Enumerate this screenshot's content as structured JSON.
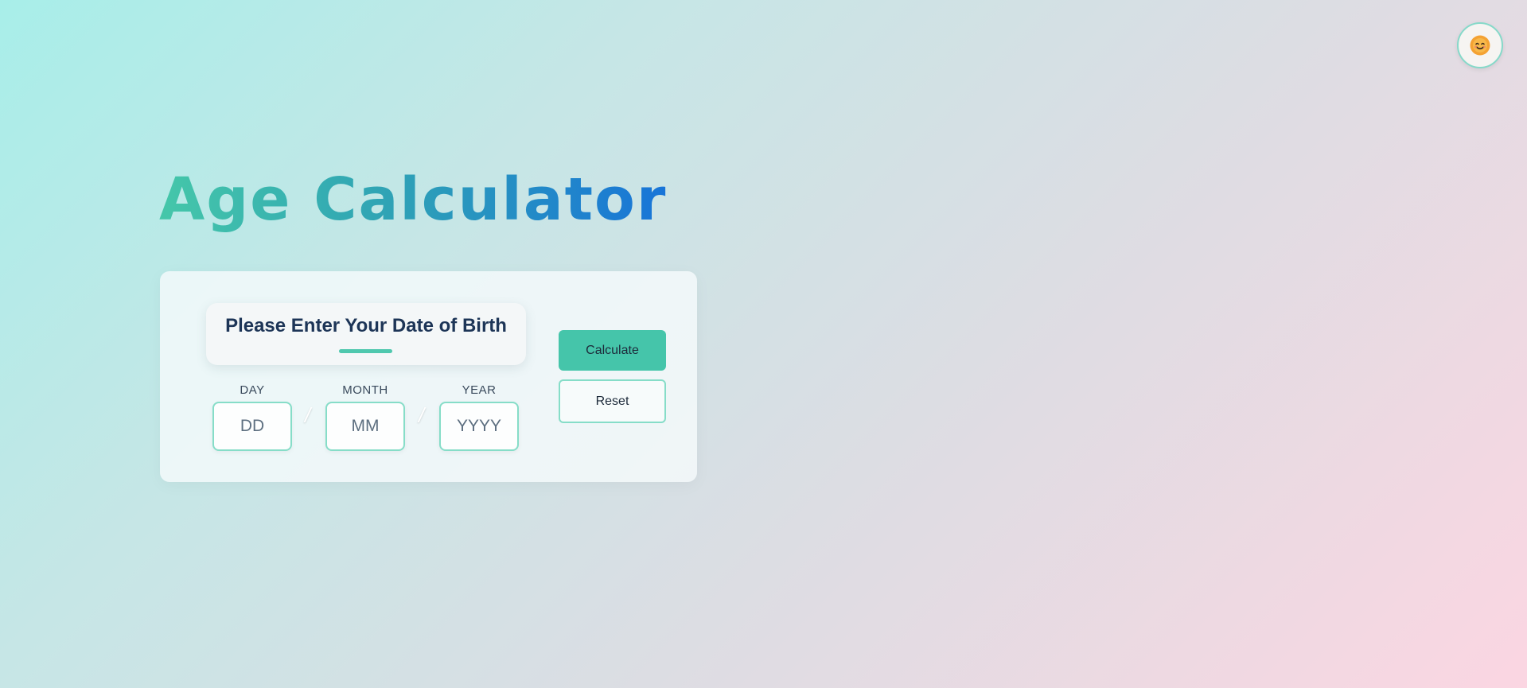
{
  "header": {
    "title": "Age Calculator",
    "theme_toggle_icon": "sun-face-icon"
  },
  "form": {
    "prompt": "Please Enter Your Date of Birth",
    "day": {
      "label": "DAY",
      "placeholder": "DD"
    },
    "month": {
      "label": "MONTH",
      "placeholder": "MM"
    },
    "year": {
      "label": "YEAR",
      "placeholder": "YYYY"
    },
    "separator": "/"
  },
  "actions": {
    "calculate_label": "Calculate",
    "reset_label": "Reset"
  },
  "colors": {
    "accent": "#45c5aa",
    "title_gradient_start": "#45c7a9",
    "title_gradient_end": "#1874d8",
    "text_dark": "#1d3557"
  }
}
